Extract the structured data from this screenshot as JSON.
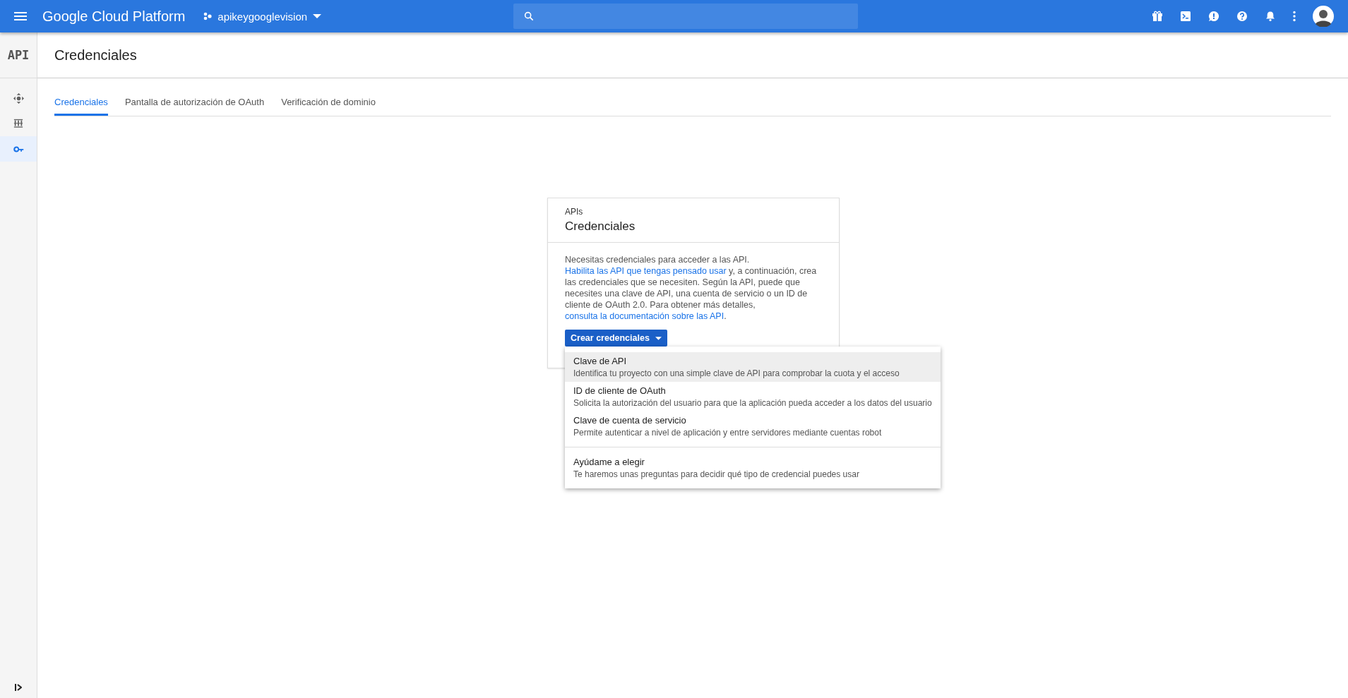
{
  "topbar": {
    "brand": "Google Cloud Platform",
    "project": "apikeygooglevision"
  },
  "sidebar": {
    "logo": "API",
    "items": [
      {
        "kind": "dashboard",
        "selected": false
      },
      {
        "kind": "library",
        "selected": false
      },
      {
        "kind": "key",
        "selected": true
      }
    ]
  },
  "page": {
    "title": "Credenciales"
  },
  "tabs": [
    {
      "label": "Credenciales",
      "selected": true
    },
    {
      "label": "Pantalla de autorización de OAuth",
      "selected": false
    },
    {
      "label": "Verificación de dominio",
      "selected": false
    }
  ],
  "card": {
    "eyebrow": "APIs",
    "title": "Credenciales",
    "description": [
      {
        "kind": "text",
        "text": "Necesitas credenciales para acceder a las API. "
      },
      {
        "kind": "link",
        "text": "Habilita las API que tengas pensado usar"
      },
      {
        "kind": "text",
        "text": " y, a continuación, crea las credenciales que se necesiten. Según la API, puede que necesites una clave de API, una cuenta de servicio o un ID de cliente de OAuth 2.0. Para obtener más detalles, "
      },
      {
        "kind": "link",
        "text": "consulta la documentación sobre las API"
      },
      {
        "kind": "text",
        "text": "."
      }
    ],
    "button": "Crear credenciales"
  },
  "menu": {
    "sections": [
      [
        {
          "title": "Clave de API",
          "subtitle": "Identifica tu proyecto con una simple clave de API para comprobar la cuota y el acceso",
          "selected": true
        },
        {
          "title": "ID de cliente de OAuth",
          "subtitle": "Solicita la autorización del usuario para que la aplicación pueda acceder a los datos del usuario",
          "selected": false
        },
        {
          "title": "Clave de cuenta de servicio",
          "subtitle": "Permite autenticar a nivel de aplicación y entre servidores mediante cuentas robot",
          "selected": false
        }
      ],
      [
        {
          "title": "Ayúdame a elegir",
          "subtitle": "Te haremos unas preguntas para decidir qué tipo de credencial puedes usar",
          "selected": false
        }
      ]
    ]
  }
}
